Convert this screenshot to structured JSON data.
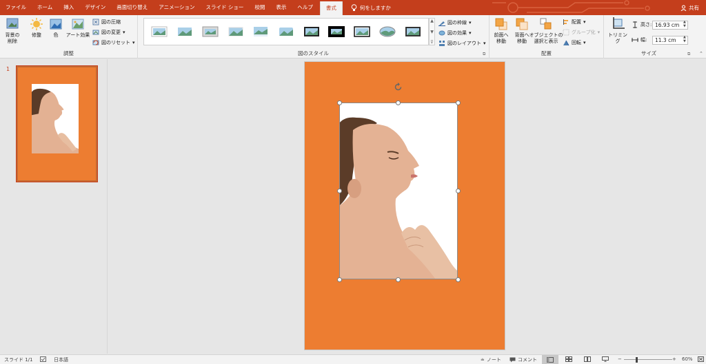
{
  "tabs": [
    "ファイル",
    "ホーム",
    "挿入",
    "デザイン",
    "画面切り替え",
    "アニメーション",
    "スライド ショー",
    "校閲",
    "表示",
    "ヘルプ",
    "書式"
  ],
  "active_tab": "書式",
  "tell_me": "何をしますか",
  "share": "共有",
  "ribbon": {
    "adjust": {
      "label": "調整",
      "remove_bg": "背景の\n削除",
      "corrections": "修整",
      "color": "色",
      "artistic": "アート効果",
      "compress": "図の圧縮",
      "change": "図の変更",
      "reset": "図のリセット"
    },
    "styles": {
      "label": "図のスタイル",
      "border": "図の枠線",
      "effects": "図の効果",
      "layout": "図のレイアウト"
    },
    "arrange": {
      "label": "配置",
      "forward": "前面へ\n移動",
      "backward": "背面へ\n移動",
      "selection": "オブジェクトの\n選択と表示",
      "align": "配置",
      "group": "グループ化",
      "rotate": "回転"
    },
    "size": {
      "label": "サイズ",
      "crop": "トリミング",
      "height_label": "高さ:",
      "height_value": "16.93 cm",
      "width_label": "幅:",
      "width_value": "11.3 cm"
    }
  },
  "slide_number": "1",
  "status": {
    "slide_info": "スライド 1/1",
    "language": "日本語",
    "notes": "ノート",
    "comments": "コメント",
    "zoom": "60%"
  },
  "colors": {
    "accent": "#c43e1c",
    "slide_bg": "#ed7d31"
  }
}
